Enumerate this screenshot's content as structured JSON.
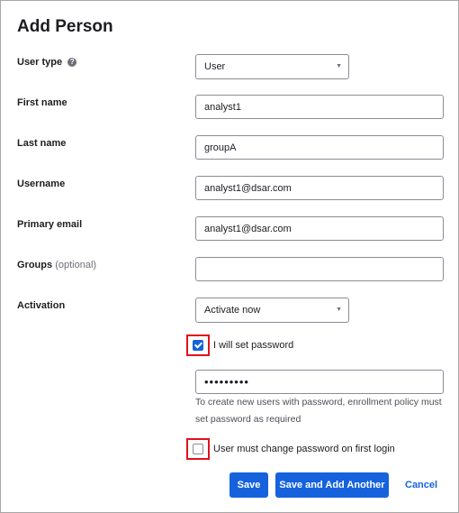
{
  "dialog": {
    "title": "Add Person"
  },
  "fields": {
    "user_type": {
      "label": "User type",
      "value": "User",
      "help_icon": "question-circle-icon"
    },
    "first_name": {
      "label": "First name",
      "value": "analyst1"
    },
    "last_name": {
      "label": "Last name",
      "value": "groupA"
    },
    "username": {
      "label": "Username",
      "value": "analyst1@dsar.com"
    },
    "primary_email": {
      "label": "Primary email",
      "value": "analyst1@dsar.com"
    },
    "groups": {
      "label": "Groups",
      "optional": "(optional)",
      "value": ""
    },
    "activation": {
      "label": "Activation",
      "value": "Activate now"
    }
  },
  "set_password": {
    "label": "I will set password",
    "checked": true
  },
  "password": {
    "value": "•••••••••"
  },
  "hint": "To create new users with password, enrollment policy must set password as required",
  "must_change": {
    "label": "User must change password on first login",
    "checked": false
  },
  "buttons": {
    "save": "Save",
    "save_add": "Save and Add Another",
    "cancel": "Cancel"
  },
  "colors": {
    "primary": "#1662dd",
    "highlight": "#e0121b",
    "text": "#1d1d21"
  }
}
